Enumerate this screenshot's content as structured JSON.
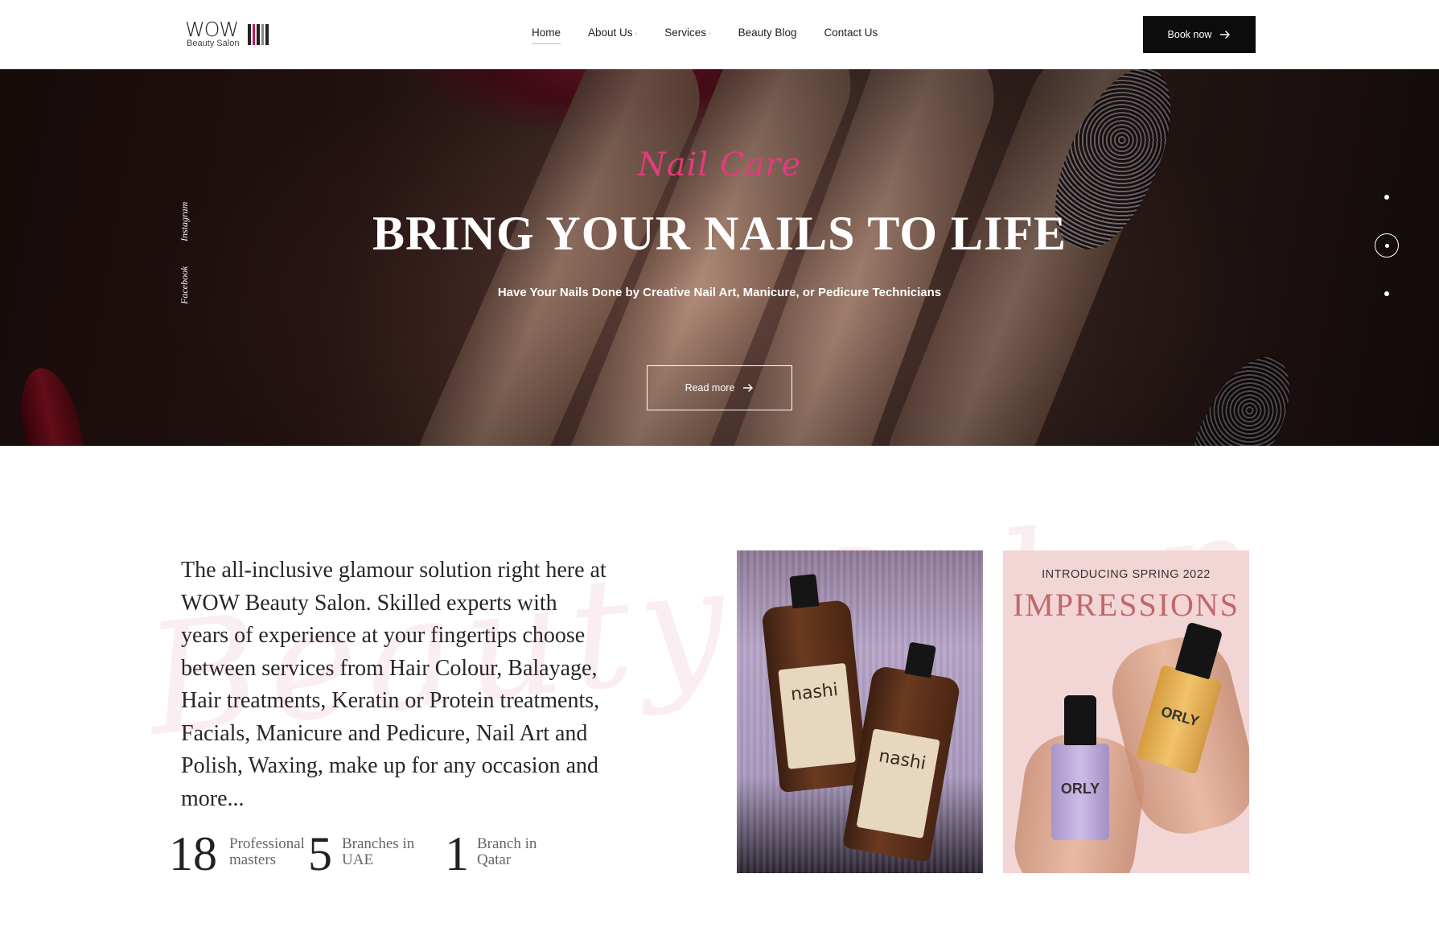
{
  "header": {
    "logo": {
      "wordmark": "WOW",
      "tagline": "Beauty Salon"
    },
    "nav": [
      {
        "label": "Home",
        "active": true,
        "has_submenu": false
      },
      {
        "label": "About Us",
        "active": false,
        "has_submenu": true
      },
      {
        "label": "Services",
        "active": false,
        "has_submenu": true
      },
      {
        "label": "Beauty Blog",
        "active": false,
        "has_submenu": false
      },
      {
        "label": "Contact Us",
        "active": false,
        "has_submenu": false
      }
    ],
    "book_button": {
      "label": "Book now",
      "icon": "arrow-right-icon"
    }
  },
  "hero": {
    "script_title": "Nail Care",
    "title": "BRING YOUR NAILS TO LIFE",
    "subtitle": "Have Your Nails Done by Creative Nail Art, Manicure, or Pedicure Technicians",
    "cta": {
      "label": "Read more",
      "icon": "arrow-right-icon"
    },
    "social": [
      "Instagram",
      "Facebook"
    ],
    "slider": {
      "slide_count": 3,
      "active_index": 1
    }
  },
  "intro": {
    "text": "The all-inclusive glamour solution right here at WOW Beauty Salon. Skilled experts with years of experience at your fingertips choose between services from Hair Colour, Balayage, Hair treatments, Keratin or Protein treatments, Facials, Manicure and Pedicure, Nail Art and Polish, Waxing, make up for any occasion and more...",
    "stats": [
      {
        "number": "18",
        "label_line1": "Professional",
        "label_line2": "masters"
      },
      {
        "number": "5",
        "label_line1": "Branches in",
        "label_line2": "UAE"
      },
      {
        "number": "1",
        "label_line1": "Branch in",
        "label_line2": "Qatar"
      }
    ],
    "photo_products": {
      "bottle_brand": "nashi"
    },
    "promo": {
      "kicker": "INTRODUCING SPRING 2022",
      "title": "IMPRESSIONS",
      "polish_brand": "ORLY"
    }
  },
  "colors": {
    "accent_pink": "#e23c7c",
    "promo_title": "#c1676a",
    "button_dark": "#0c0c0c"
  }
}
